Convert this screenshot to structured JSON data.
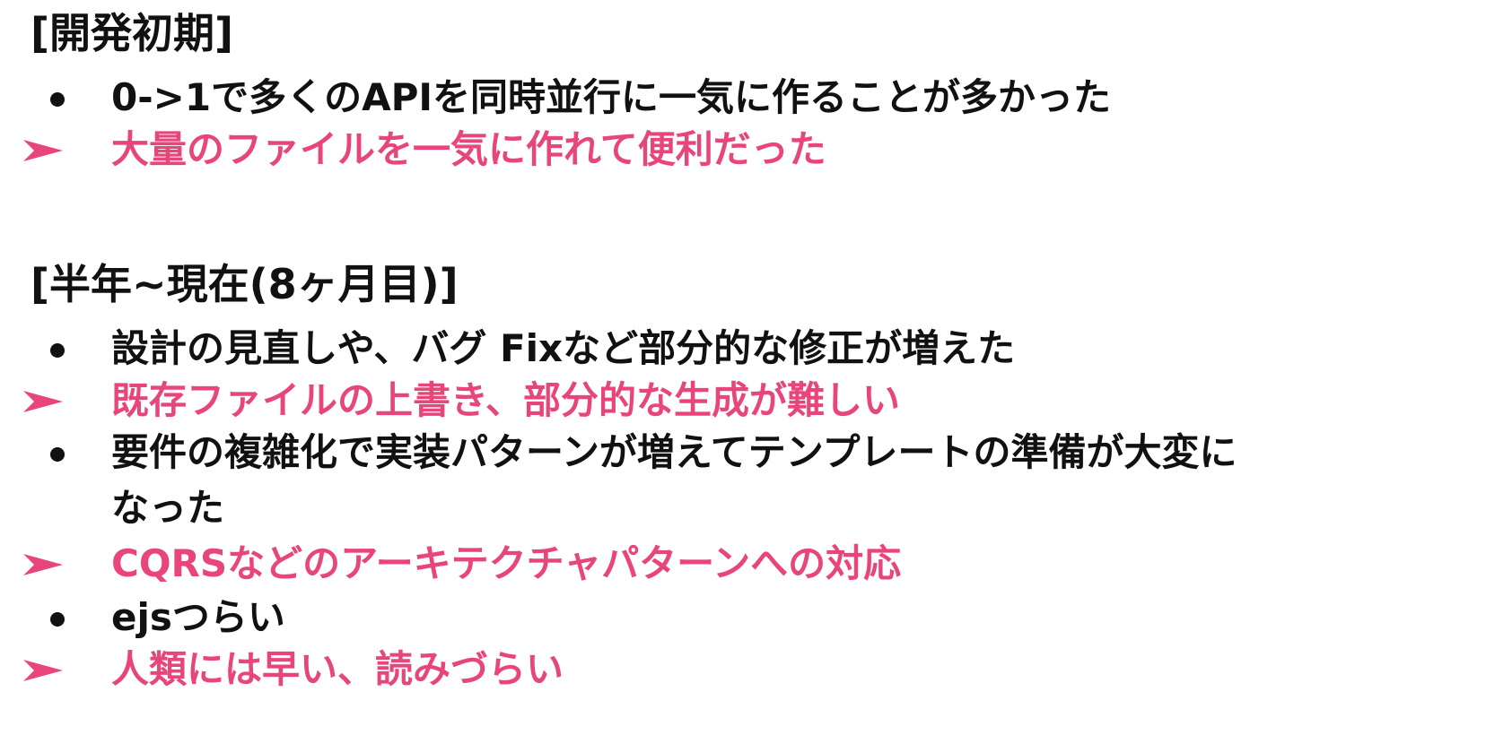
{
  "colors": {
    "text": "#111111",
    "accent": "#e8457a"
  },
  "sections": [
    {
      "heading": "[開発初期]",
      "items": [
        {
          "marker": "bullet-icon",
          "text": "0->1で多くのAPIを同時並行に一気に作ることが多かった",
          "style": "black"
        },
        {
          "marker": "arrow-icon",
          "text": "大量のファイルを一気に作れて便利だった",
          "style": "pink"
        }
      ]
    },
    {
      "heading": "[半年~現在(8ヶ月目)]",
      "items": [
        {
          "marker": "bullet-icon",
          "text": "設計の見直しや、バグ Fixなど部分的な修正が増えた",
          "style": "black"
        },
        {
          "marker": "arrow-icon",
          "text": "既存ファイルの上書き、部分的な生成が難しい",
          "style": "pink"
        },
        {
          "marker": "bullet-icon",
          "text": "要件の複雑化で実装パターンが増えてテンプレートの準備が大変に",
          "continuation": "なった",
          "style": "black"
        },
        {
          "marker": "arrow-icon",
          "text": "CQRSなどのアーキテクチャパターンへの対応",
          "style": "pink"
        },
        {
          "marker": "bullet-icon",
          "text": "ejsつらい",
          "style": "black"
        },
        {
          "marker": "arrow-icon",
          "text": "人類には早い、読みづらい",
          "style": "pink"
        }
      ]
    }
  ]
}
